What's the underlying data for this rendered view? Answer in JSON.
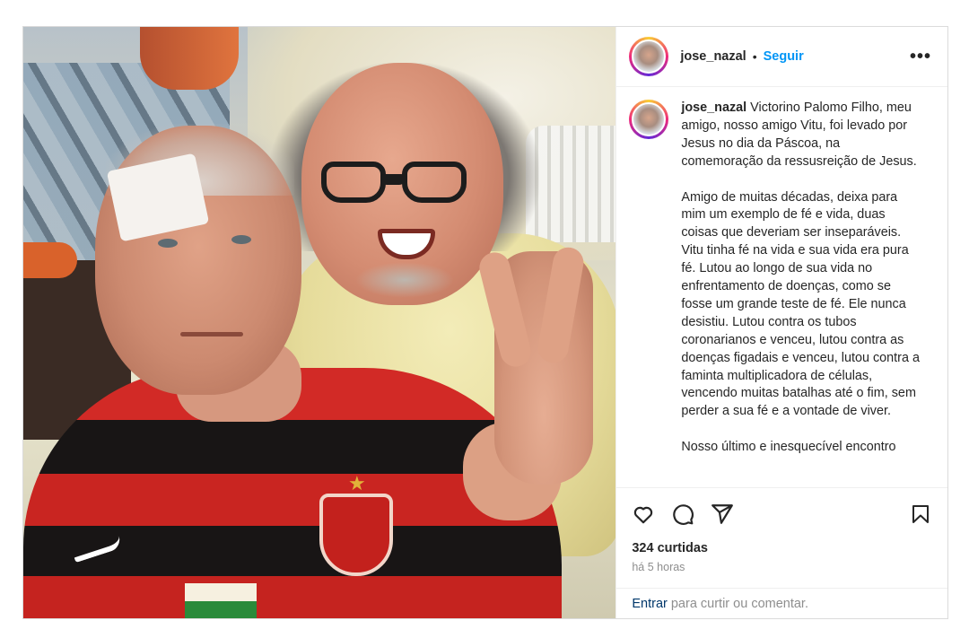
{
  "post": {
    "username": "jose_nazal",
    "dot": "•",
    "follow_label": "Seguir",
    "more_label": "•••",
    "caption_username": "jose_nazal",
    "caption_paragraphs": [
      "Victorino Palomo Filho, meu amigo, nosso amigo Vitu, foi levado por Jesus no dia da Páscoa, na comemoração da ressusreição de Jesus.",
      "Amigo de muitas décadas, deixa para mim um exemplo de fé e vida, duas coisas que deveriam ser inseparáveis. Vitu tinha fé na vida e sua vida era pura fé. Lutou ao longo de sua vida no enfrentamento de doenças, como se fosse um grande teste de fé. Ele nunca desistiu. Lutou contra os tubos coronarianos e venceu, lutou contra as doenças figadais e venceu, lutou contra a faminta multiplicadora de células, vencendo muitas batalhas até o fim, sem perder a sua fé e a vontade de viver.",
      "Nosso último e inesquecível encontro"
    ],
    "likes_text": "324 curtidas",
    "time_text": "há 5 horas",
    "login_link": "Entrar",
    "login_text": "para curtir ou comentar."
  },
  "icons": {
    "like": "heart-icon",
    "comment": "comment-icon",
    "share": "send-icon",
    "save": "bookmark-icon"
  },
  "colors": {
    "accent": "#0095f6",
    "link": "#00376b",
    "muted": "#8e8e8e",
    "border": "#dbdbdb"
  }
}
